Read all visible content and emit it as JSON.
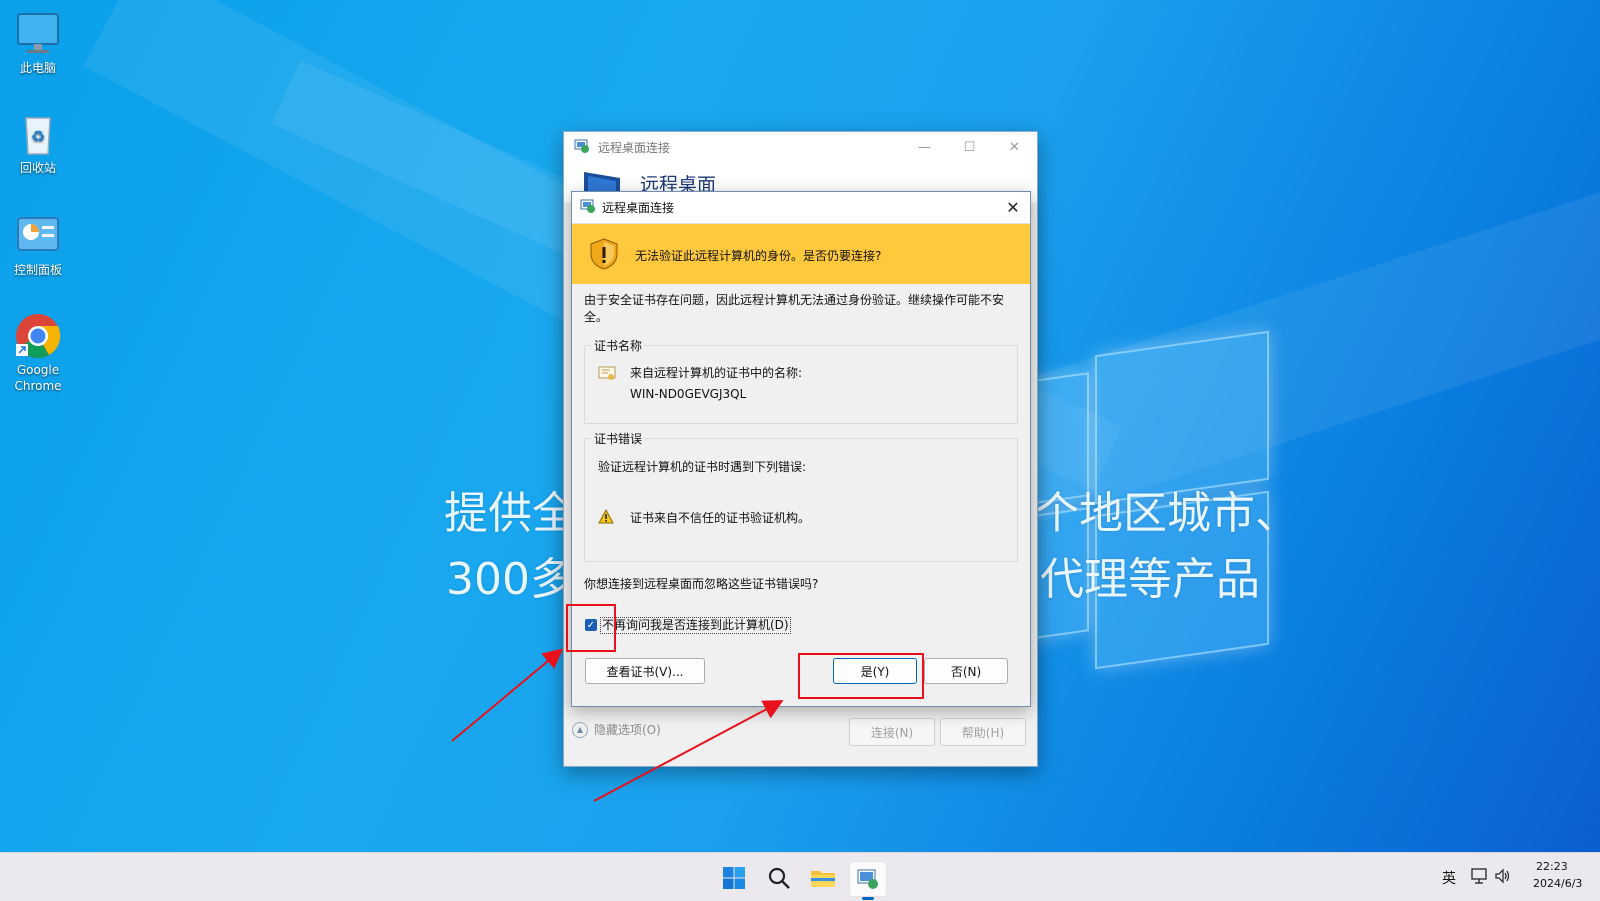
{
  "desktop": {
    "icons": [
      {
        "label": "此电脑",
        "icon": "monitor-icon"
      },
      {
        "label": "回收站",
        "icon": "recycle-bin-icon"
      },
      {
        "label": "控制面板",
        "icon": "control-panel-icon"
      },
      {
        "label_line1": "Google",
        "label_line2": "Chrome",
        "icon": "chrome-icon"
      }
    ],
    "background_text": {
      "line1_left": "提供全",
      "line1_right": "个地区城市、",
      "line2_left": "300多",
      "line2_right": "代理等产品"
    }
  },
  "main_window": {
    "title": "远程桌面连接",
    "banner_title": "远程桌面",
    "show_options": "隐藏选项(O)",
    "connect_button": "连接(N)",
    "help_button": "帮助(H)"
  },
  "dialog": {
    "title": "远程桌面连接",
    "warning_text": "无法验证此远程计算机的身份。是否仍要连接?",
    "description_line1": "由于安全证书存在问题，因此远程计算机无法通过身份验证。继续操作可能不安",
    "description_line2": "全。",
    "cert_name_group": "证书名称",
    "cert_name_label": "来自远程计算机的证书中的名称:",
    "cert_name_value": "WIN-ND0GEVGJ3QL",
    "cert_error_group": "证书错误",
    "cert_error_intro": "验证远程计算机的证书时遇到下列错误:",
    "cert_error_item": "证书来自不信任的证书验证机构。",
    "question": "你想连接到远程桌面而忽略这些证书错误吗?",
    "dont_ask_checkbox": "不再询问我是否连接到此计算机(D)",
    "dont_ask_checked": true,
    "view_cert_button": "查看证书(V)...",
    "yes_button": "是(Y)",
    "no_button": "否(N)"
  },
  "taskbar": {
    "apps": [
      "windows-start-icon",
      "search-icon",
      "file-explorer-icon",
      "remote-desktop-icon"
    ],
    "ime": "英",
    "time": "22:23",
    "date": "2024/6/3"
  },
  "colors": {
    "warning_bar": "#ffc83d",
    "annotation_red": "#e8101a",
    "checkbox_blue": "#1a5fb4"
  }
}
